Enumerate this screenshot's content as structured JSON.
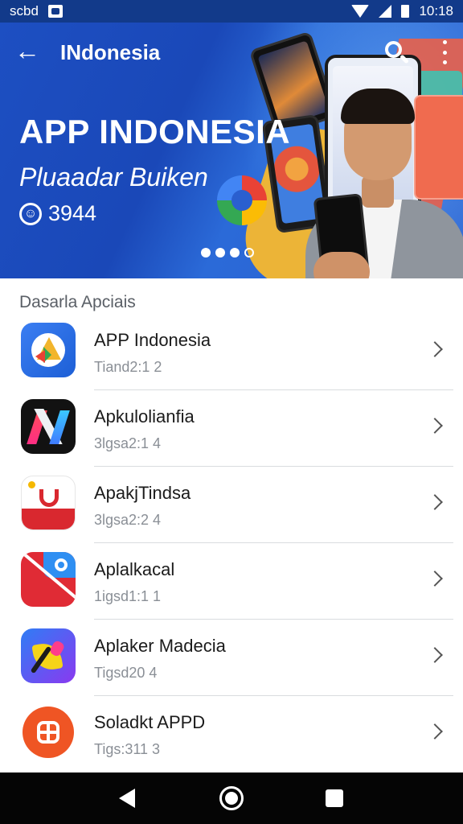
{
  "status_bar": {
    "left_text": "scbd",
    "time": "10:18"
  },
  "app_bar": {
    "title": "INdonesia"
  },
  "hero": {
    "title": "APP INDONESIA",
    "subtitle": "Pluaadar Buiken",
    "count": "3944",
    "count_icon": "user-badge-icon",
    "carousel": {
      "total": 4,
      "active": 3
    }
  },
  "section": {
    "header": "Dasarla Apciais"
  },
  "apps": [
    {
      "name": "APP Indonesia",
      "meta": "Tiand2:1 2",
      "icon": "drive-triangle-icon"
    },
    {
      "name": "Apkulolianfia",
      "meta": "3lgsa2:1 4",
      "icon": "stripes-n-icon"
    },
    {
      "name": "ApakjTindsa",
      "meta": "3lgsa2:2 4",
      "icon": "heart-basket-icon"
    },
    {
      "name": "Aplalkacal",
      "meta": "1igsd1:1 1",
      "icon": "eye-slash-icon"
    },
    {
      "name": "Aplaker Madecia",
      "meta": "Tigsd20 4",
      "icon": "paint-leaf-icon"
    },
    {
      "name": "Soladkt APPD",
      "meta": "Tigs:311 3",
      "icon": "plus-circle-icon"
    }
  ],
  "colors": {
    "hero_blue": "#1d4fc2",
    "status_bar": "#123a8a",
    "nav_bar": "#050505"
  }
}
